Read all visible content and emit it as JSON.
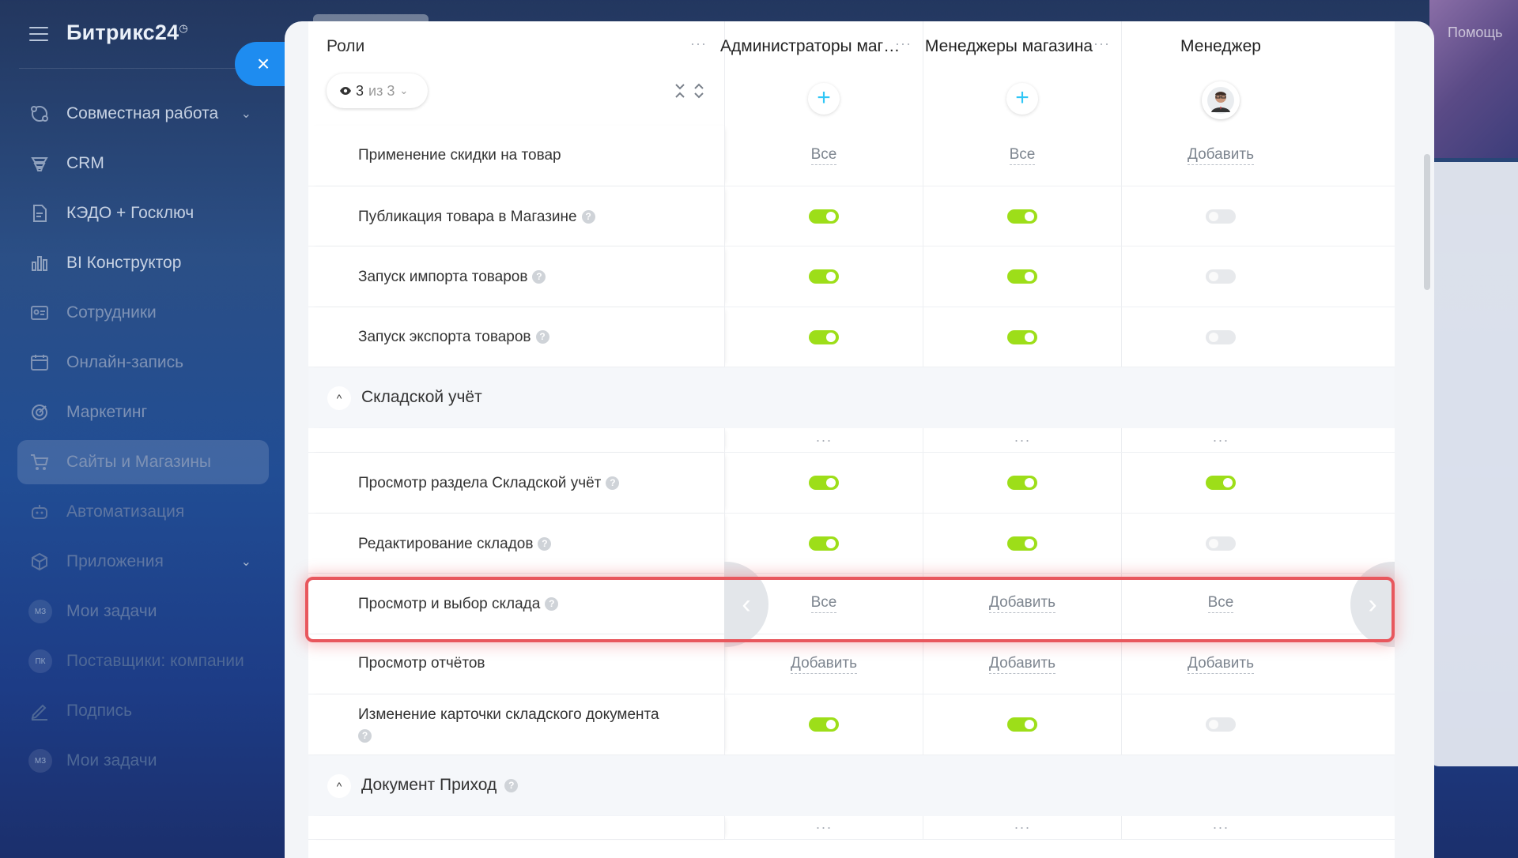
{
  "sidebar": {
    "logo": "Битрикс24",
    "logo_mark": "◷",
    "items": [
      {
        "label": "Совместная работа",
        "icon": "collab-icon",
        "chevron": "⌄"
      },
      {
        "label": "CRM",
        "icon": "crm-icon"
      },
      {
        "label": "КЭДО + Госключ",
        "icon": "document-icon"
      },
      {
        "label": "BI Конструктор",
        "icon": "chart-icon"
      },
      {
        "label": "Сотрудники",
        "icon": "employees-icon"
      },
      {
        "label": "Онлайн-запись",
        "icon": "calendar-icon"
      },
      {
        "label": "Маркетинг",
        "icon": "marketing-icon"
      },
      {
        "label": "Сайты и Магазины",
        "icon": "cart-icon"
      },
      {
        "label": "Автоматизация",
        "icon": "robot-icon"
      },
      {
        "label": "Приложения",
        "icon": "box-icon",
        "chevron": "⌄"
      },
      {
        "label": "Мои задачи",
        "badge": "МЗ"
      },
      {
        "label": "Поставщики: компании",
        "badge": "ПК"
      },
      {
        "label": "Подпись",
        "icon": "sign-icon"
      },
      {
        "label": "Мои задачи",
        "badge": "МЗ"
      }
    ]
  },
  "topbar": {
    "help": "Помощь"
  },
  "close_icon": "×",
  "header": {
    "roles_title": "Роли",
    "dots": "···",
    "view_count": "3",
    "view_of": "из 3",
    "view_chevron": "⌄",
    "columns": [
      {
        "title": "Администраторы маг…",
        "action": "+"
      },
      {
        "title": "Менеджеры магазина",
        "action": "+"
      },
      {
        "title": "Менеджер",
        "action": "avatar"
      }
    ]
  },
  "rows": {
    "r1": {
      "name": "Применение скидки на товар",
      "c1": "Все",
      "c2": "Все",
      "c3": "Добавить"
    },
    "r2": {
      "name": "Публикация товара в Магазине",
      "c1": "on",
      "c2": "on",
      "c3": "off"
    },
    "r3": {
      "name": "Запуск импорта товаров",
      "c1": "on",
      "c2": "on",
      "c3": "off"
    },
    "r4": {
      "name": "Запуск экспорта товаров",
      "c1": "on",
      "c2": "on",
      "c3": "off"
    },
    "section1": {
      "title": "Складской учёт",
      "chevron": "^"
    },
    "r5": {
      "name": "Просмотр раздела Складской учёт",
      "c1": "on",
      "c2": "on",
      "c3": "on"
    },
    "r6": {
      "name": "Редактирование складов",
      "c1": "on",
      "c2": "on",
      "c3": "off"
    },
    "r7": {
      "name": "Просмотр и выбор склада",
      "c1": "Все",
      "c2": "Добавить",
      "c3": "Все"
    },
    "r8": {
      "name": "Просмотр отчётов",
      "c1": "Добавить",
      "c2": "Добавить",
      "c3": "Добавить"
    },
    "r9": {
      "name": "Изменение карточки складского документа",
      "c1": "on",
      "c2": "on",
      "c3": "off"
    },
    "section2": {
      "title": "Документ Приход",
      "chevron": "^"
    }
  },
  "help_mark": "?",
  "nav": {
    "prev": "‹",
    "next": "›"
  },
  "colors": {
    "accent": "#1e8cf0",
    "toggle_on": "#9dde19",
    "highlight": "#e8575d",
    "plus": "#2fc6f6"
  }
}
